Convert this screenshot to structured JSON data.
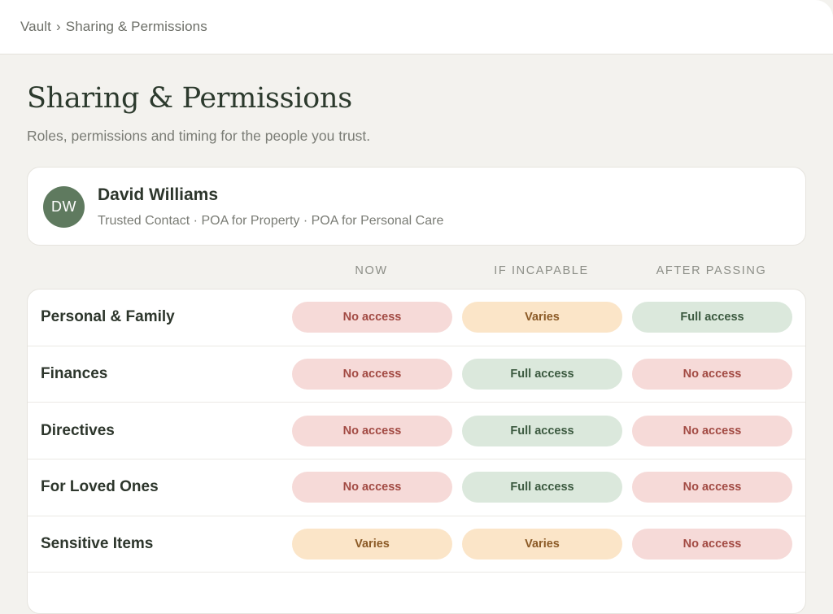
{
  "breadcrumb": {
    "root": "Vault",
    "separator": "›",
    "current": "Sharing & Permissions"
  },
  "page": {
    "title": "Sharing & Permissions",
    "subtitle": "Roles, permissions and timing for the people you trust."
  },
  "contact": {
    "initials": "DW",
    "name": "David Williams",
    "roles": "Trusted Contact · POA for Property · POA for Personal Care",
    "avatar_color": "#5f7a5f"
  },
  "columns": [
    "NOW",
    "IF INCAPABLE",
    "AFTER PASSING"
  ],
  "status_colors": {
    "no_access": {
      "bg": "#f6dad8",
      "text": "#a24a43"
    },
    "full_access": {
      "bg": "#dbe8dc",
      "text": "#3c5a40"
    },
    "varies": {
      "bg": "#fbe5c8",
      "text": "#8b5a26"
    }
  },
  "rows": [
    {
      "label": "Personal & Family",
      "cells": [
        "No access",
        "Varies",
        "Full access"
      ]
    },
    {
      "label": "Finances",
      "cells": [
        "No access",
        "Full access",
        "No access"
      ]
    },
    {
      "label": "Directives",
      "cells": [
        "No access",
        "Full access",
        "No access"
      ]
    },
    {
      "label": "For Loved Ones",
      "cells": [
        "No access",
        "Full access",
        "No access"
      ]
    },
    {
      "label": "Sensitive Items",
      "cells": [
        "Varies",
        "Varies",
        "No access"
      ]
    }
  ]
}
